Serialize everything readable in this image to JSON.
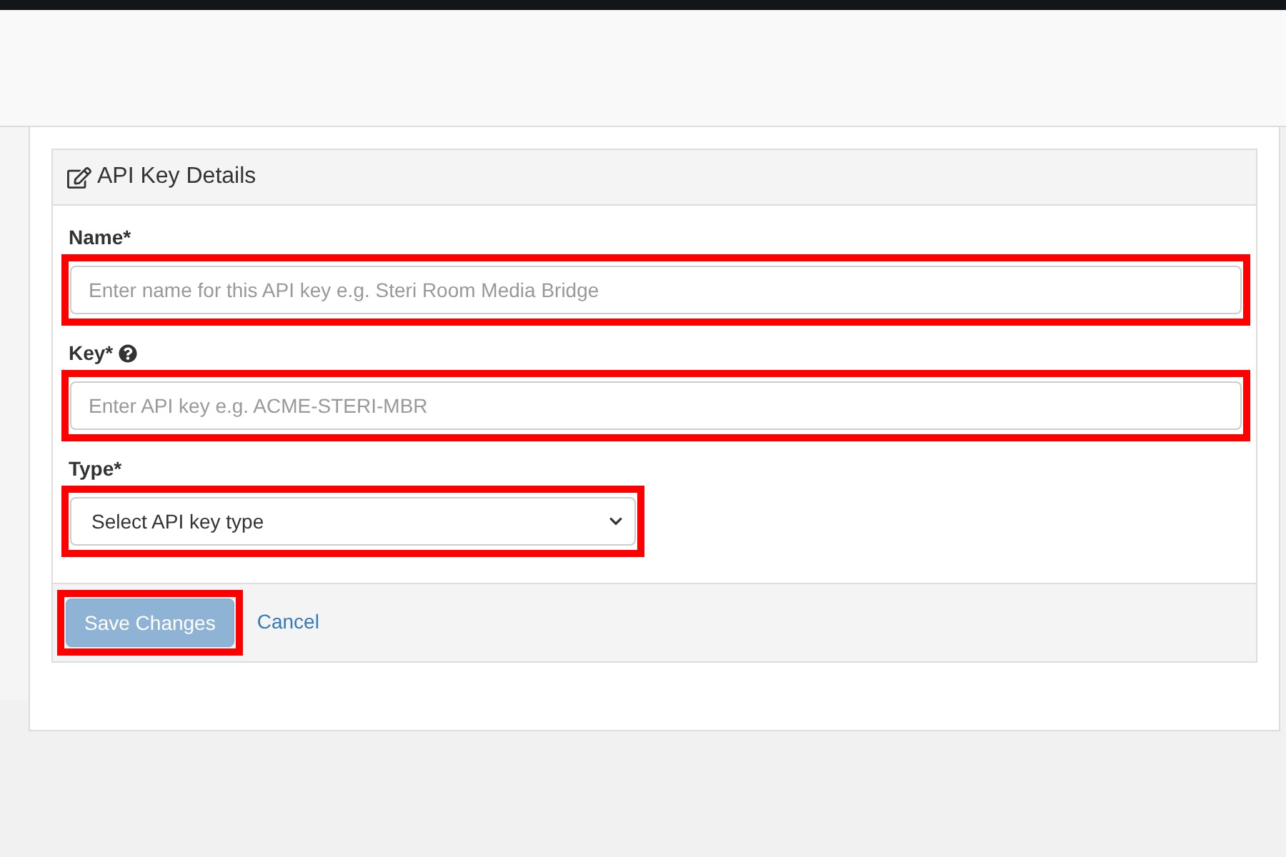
{
  "card": {
    "title": "API Key Details"
  },
  "fields": [
    {
      "kind": "text",
      "label": "Name*",
      "help": false,
      "placeholder": "Enter name for this API key e.g. Steri Room Media Bridge",
      "highlighted": true
    },
    {
      "kind": "text",
      "label": "Key*",
      "help": true,
      "placeholder": "Enter API key e.g. ACME-STERI-MBR",
      "highlighted": true
    },
    {
      "kind": "select",
      "label": "Type*",
      "help": false,
      "value": "Select API key type",
      "highlighted": true
    }
  ],
  "actions": [
    {
      "kind": "button",
      "label": "Save Changes",
      "disabled": true,
      "highlighted": true
    },
    {
      "kind": "link",
      "label": "Cancel",
      "disabled": false,
      "highlighted": false
    }
  ]
}
